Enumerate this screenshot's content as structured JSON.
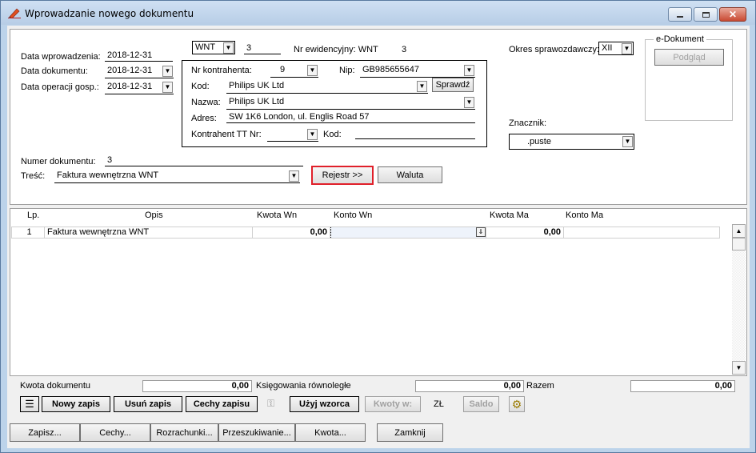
{
  "window": {
    "title": "Wprowadzanie nowego dokumentu"
  },
  "header": {
    "data_wprowadzenia_label": "Data wprowadzenia:",
    "data_wprowadzenia": "2018-12-31",
    "data_dokumentu_label": "Data dokumentu:",
    "data_dokumentu": "2018-12-31",
    "data_operacji_label": "Data operacji gosp.:",
    "data_operacji": "2018-12-31",
    "typ": "WNT",
    "numer": "3",
    "nr_ewidencyjny_label": "Nr ewidencyjny: WNT",
    "nr_ewidencyjny": "3",
    "okres_label": "Okres sprawozdawczy:",
    "okres": "XII",
    "edokument_label": "e-Dokument",
    "podglad": "Podgląd",
    "znacznik_label": "Znacznik:",
    "znacznik": ".puste",
    "numer_dokumentu_label": "Numer dokumentu:",
    "numer_dokumentu": "3",
    "tresc_label": "Treść:",
    "tresc": "Faktura wewnętrzna WNT",
    "rejestr": "Rejestr >>",
    "waluta": "Waluta"
  },
  "kontrahent": {
    "nr_label": "Nr kontrahenta:",
    "nr": "9",
    "nip_label": "Nip:",
    "nip": "GB985655647",
    "kod_label": "Kod:",
    "kod": "Philips UK Ltd",
    "sprawdz": "Sprawdź",
    "nazwa_label": "Nazwa:",
    "nazwa": "Philips UK Ltd",
    "adres_label": "Adres:",
    "adres": "SW 1K6 London, ul. Englis Road 57",
    "tt_label": "Kontrahent TT Nr:",
    "tt_kod_label": "Kod:"
  },
  "grid": {
    "columns": [
      "Lp.",
      "Opis",
      "Kwota Wn",
      "Konto Wn",
      "Kwota Ma",
      "Konto Ma"
    ],
    "rows": [
      {
        "lp": "1",
        "opis": "Faktura wewnętrzna WNT",
        "kwota_wn": "0,00",
        "konto_wn": "",
        "kwota_ma": "0,00",
        "konto_ma": ""
      }
    ]
  },
  "summary": {
    "kwota_dokumentu_label": "Kwota dokumentu",
    "kwota_dokumentu": "0,00",
    "ksiegowania_label": "Księgowania równoległe",
    "ksiegowania": "0,00",
    "razem_label": "Razem",
    "razem": "0,00"
  },
  "toolbar": {
    "nowy_zapis": "Nowy zapis",
    "usun_zapis": "Usuń zapis",
    "cechy_zapisu": "Cechy zapisu",
    "uzyj_wzorca": "Użyj wzorca",
    "kwoty_w": "Kwoty w:",
    "waluta_code": "ZŁ",
    "saldo": "Saldo"
  },
  "footer": {
    "zapisz": "Zapisz...",
    "cechy": "Cechy...",
    "rozrachunki": "Rozrachunki...",
    "przeszukiwanie": "Przeszukiwanie...",
    "kwota": "Kwota...",
    "zamknij": "Zamknij"
  },
  "colors": {
    "highlight": "#e0202a"
  }
}
